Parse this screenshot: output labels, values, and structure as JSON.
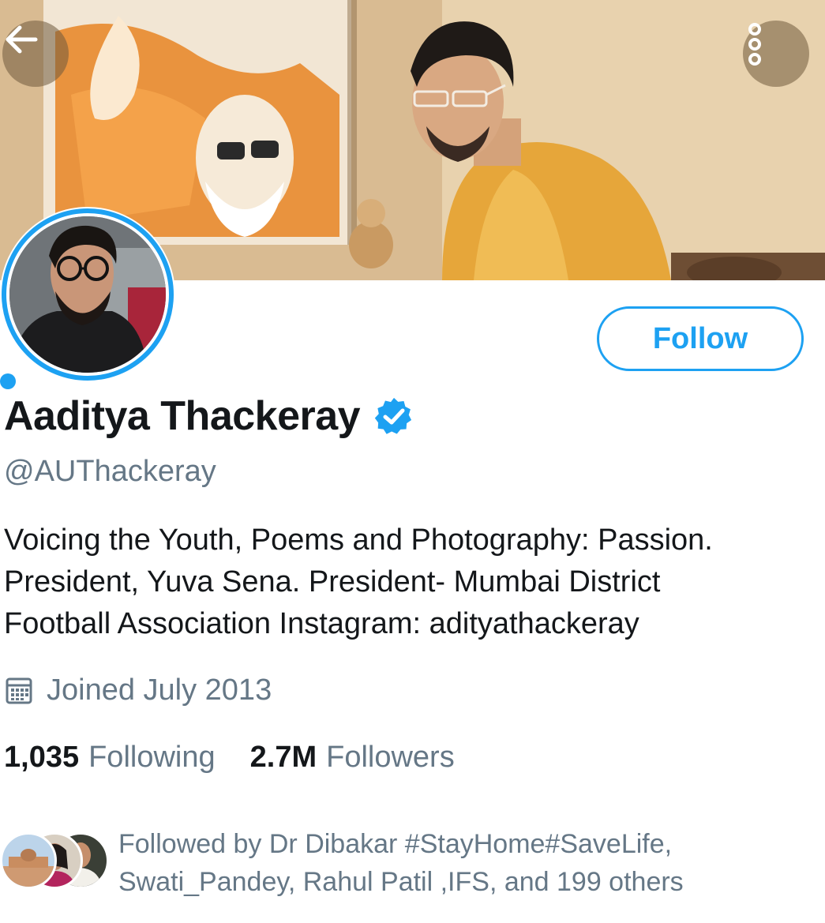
{
  "header": {
    "back_icon": "arrow-left-icon",
    "more_icon": "more-vertical-icon"
  },
  "profile": {
    "display_name": "Aaditya Thackeray",
    "verified_icon": "verified-badge-icon",
    "handle": "@AUThackeray",
    "bio_lines": [
      "Voicing the Youth, Poems and Photography: Passion.",
      "President, Yuva Sena. President- Mumbai District",
      "Football Association Instagram: adityathackeray"
    ],
    "joined_icon": "calendar-icon",
    "joined": "Joined July 2013",
    "following_count": "1,035",
    "following_label": "Following",
    "followers_count": "2.7M",
    "followers_label": "Followers",
    "follow_button": "Follow"
  },
  "followed_by": {
    "lines": [
      "Followed by Dr Dibakar #StayHome#SaveLife,",
      "Swati_Pandey, Rahul Patil ,IFS, and 199 others"
    ]
  },
  "colors": {
    "accent": "#1da1f2",
    "text_primary": "#14171a",
    "text_secondary": "#657786"
  }
}
